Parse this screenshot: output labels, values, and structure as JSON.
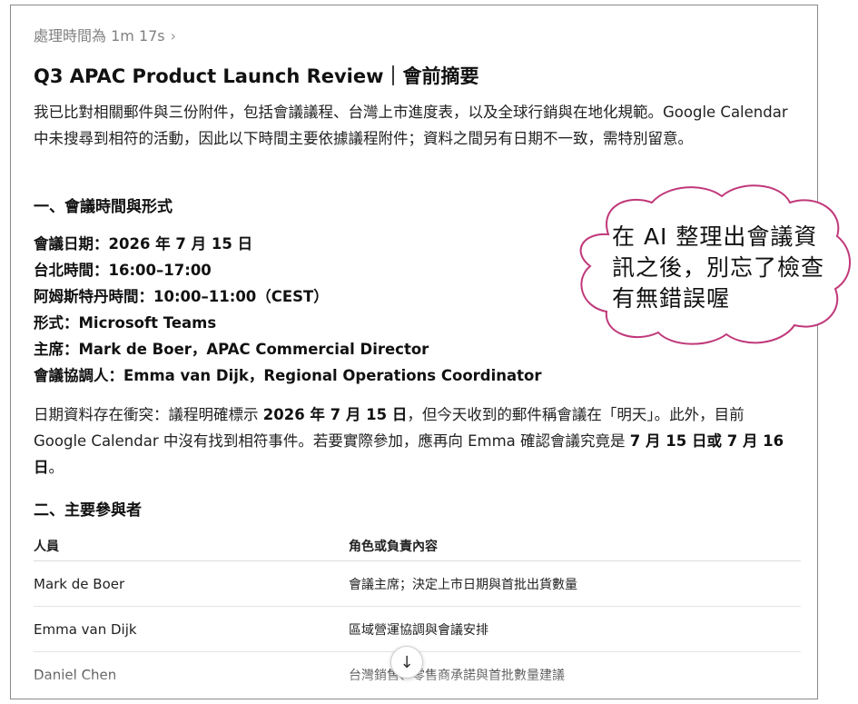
{
  "status": {
    "text": "處理時間為 1m 17s",
    "chevron": "›"
  },
  "title": "Q3 APAC Product Launch Review｜會前摘要",
  "intro": "我已比對相關郵件與三份附件，包括會議議程、台灣上市進度表，以及全球行銷與在地化規範。Google Calendar 中未搜尋到相符的活動，因此以下時間主要依據議程附件；資料之間另有日期不一致，需特別留意。",
  "section1": {
    "heading": "一、會議時間與形式",
    "rows": [
      "會議日期：2026 年 7 月 15 日",
      "台北時間：16:00–17:00",
      "阿姆斯特丹時間：10:00–11:00（CEST）",
      "形式：Microsoft Teams",
      "主席：Mark de Boer，APAC Commercial Director",
      "會議協調人：Emma van Dijk，Regional Operations Coordinator"
    ]
  },
  "conflict": {
    "t1": "日期資料存在衝突：議程明確標示 ",
    "b1": "2026 年 7 月 15 日",
    "t2": "，但今天收到的郵件稱會議在「明天」。此外，目前 Google Calendar 中沒有找到相符事件。若要實際參加，應再向 Emma 確認會議究竟是 ",
    "b2": "7 月 15 日或 7 月 16 日",
    "t3": "。"
  },
  "section2": {
    "heading": "二、主要參與者",
    "columns": [
      "人員",
      "角色或負責內容"
    ],
    "rows": [
      {
        "person": "Mark de Boer",
        "role": "會議主席；決定上市日期與首批出貨數量"
      },
      {
        "person": "Emma van Dijk",
        "role": "區域營運協調與會議安排"
      },
      {
        "person": "Daniel Chen",
        "role": "台灣銷售、零售商承諾與首批數量建議"
      }
    ]
  },
  "scroll_button": {
    "icon": "arrow-down-icon",
    "glyph": "↓"
  },
  "callout": {
    "text": "在 AI 整理出會議資訊之後，別忘了檢查有無錯誤喔",
    "border_color": "#c0387a"
  }
}
